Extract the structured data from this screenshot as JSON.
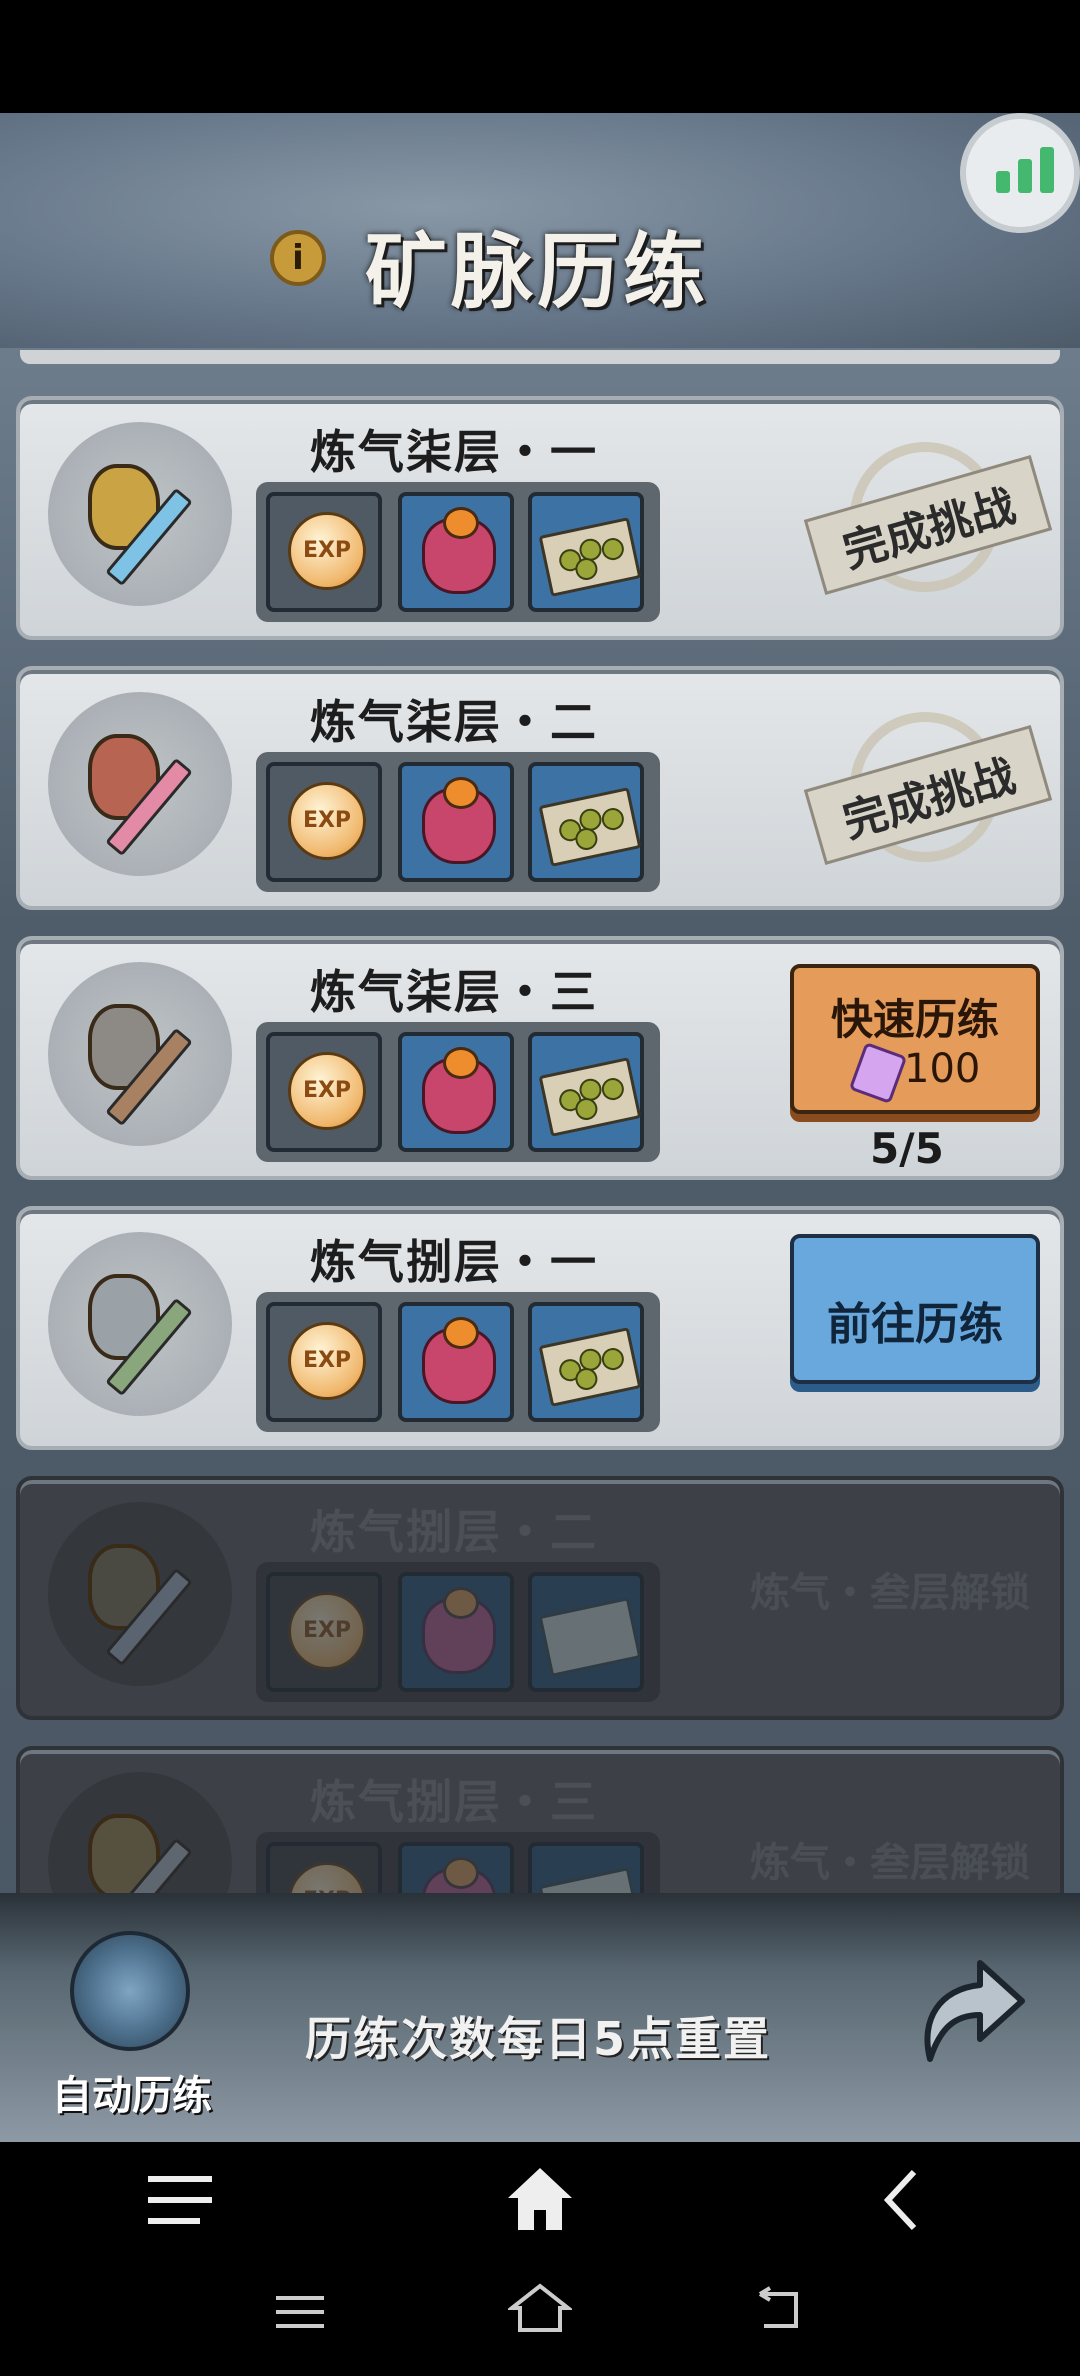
{
  "header": {
    "title": "矿脉历练",
    "info_icon": "info-icon",
    "stats_icon": "bar-chart-icon"
  },
  "colors": {
    "accent_green": "#44b86e",
    "quick_btn": "#e59b5a",
    "go_btn": "#68a8dc"
  },
  "stages": [
    {
      "name": "炼气柒层・一",
      "status": "完成挑战",
      "ore_color": "#c9a344",
      "sword_color": "#7ec3e6"
    },
    {
      "name": "炼气柒层・二",
      "status": "完成挑战",
      "ore_color": "#b76452",
      "sword_color": "#e28aa6"
    },
    {
      "name": "炼气柒层・三",
      "quick_label": "快速历练",
      "cost": "100",
      "quota": "5/5",
      "ore_color": "#8d8a86",
      "sword_color": "#a78162"
    },
    {
      "name": "炼气捌层・一",
      "go_label": "前往历练",
      "ore_color": "#9aa2a8",
      "sword_color": "#8aa67c"
    },
    {
      "name": "炼气捌层・二",
      "locked_label": "炼气・叁层解锁",
      "ore_color": "#4a4a42",
      "sword_color": "#5a6470"
    },
    {
      "name": "炼气捌层・三",
      "locked_label": "炼气・叁层解锁",
      "ore_color": "#56503e",
      "sword_color": "#5e6670"
    }
  ],
  "reward_icons": [
    "exp-orb-icon",
    "pouch-icon",
    "beans-icon"
  ],
  "exp_text": "EXP",
  "bottom": {
    "auto_label": "自动历练",
    "reset_note": "历练次数每日5点重置"
  }
}
